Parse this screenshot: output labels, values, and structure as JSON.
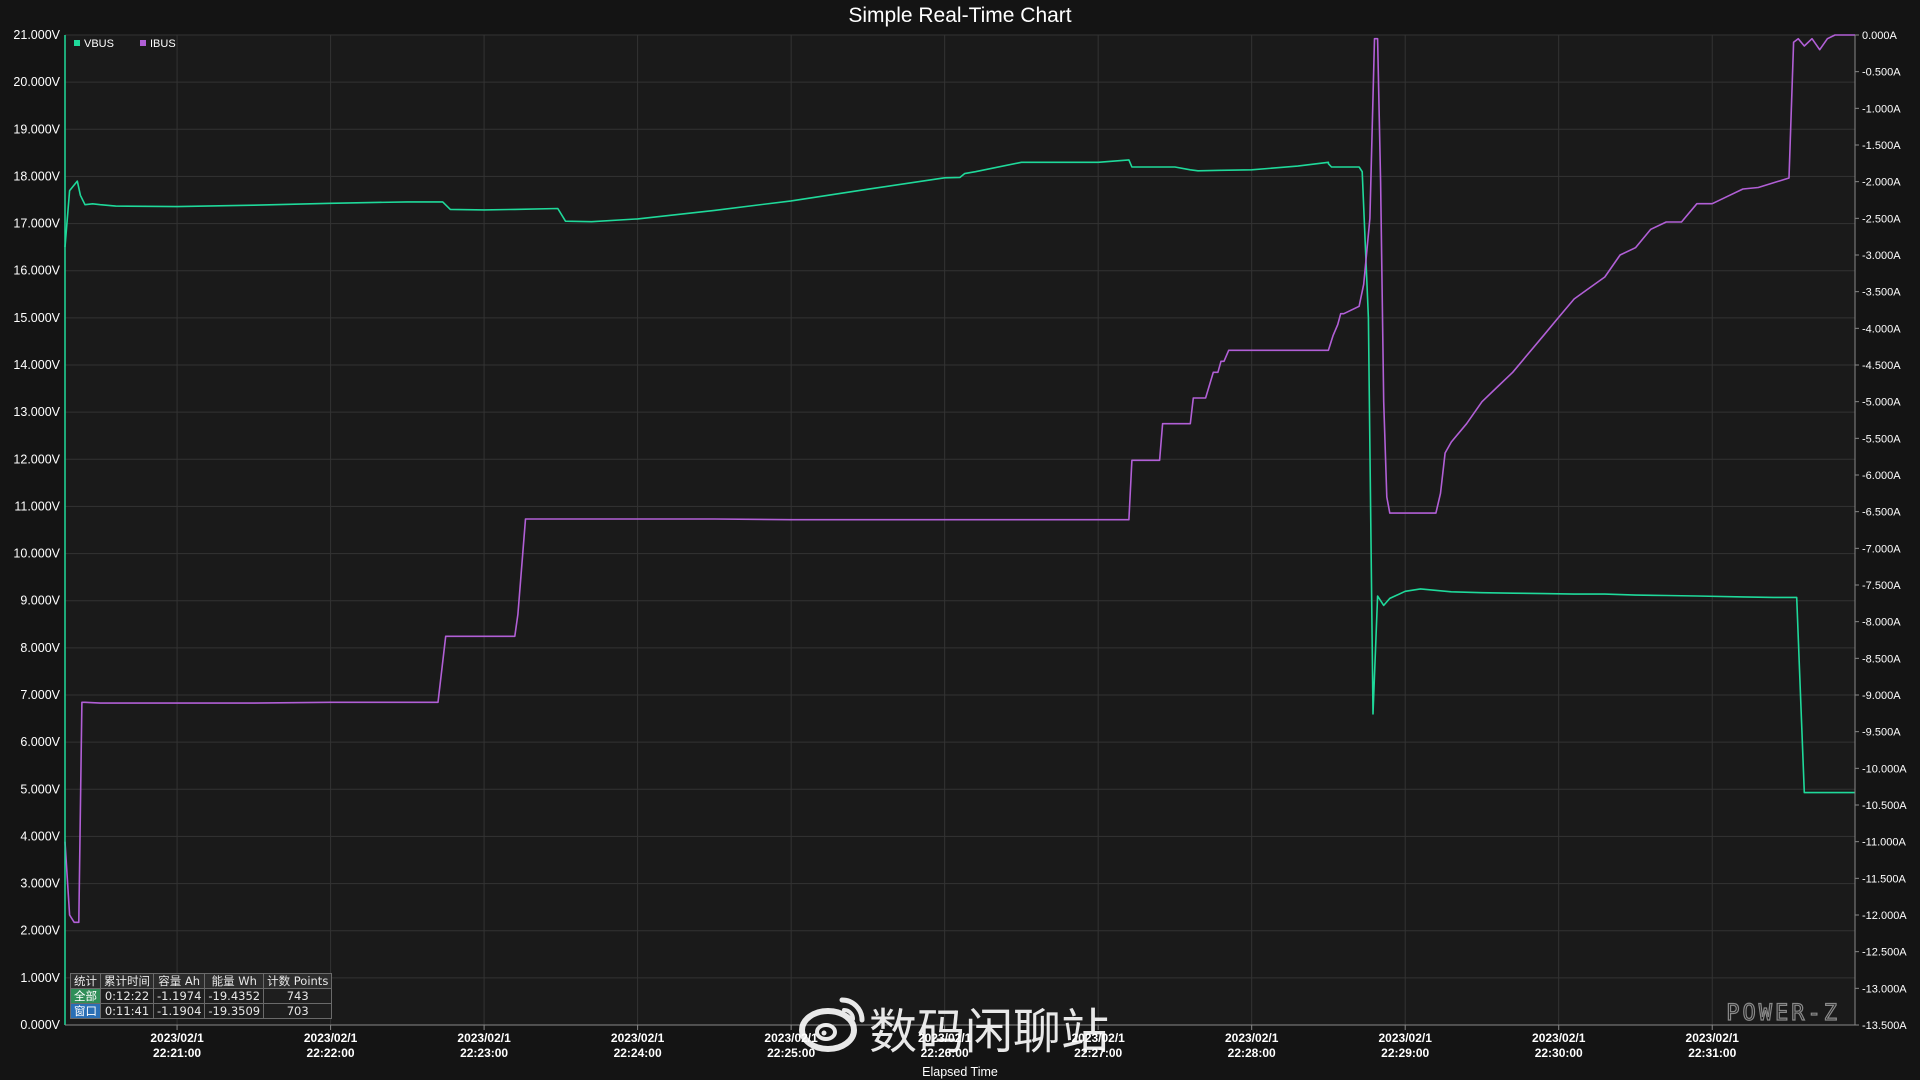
{
  "colors": {
    "background": "#141414",
    "plot_background": "#1a1a1a",
    "grid": "#333333",
    "vbus": "#1fd99a",
    "ibus": "#b15fd6",
    "text": "#ffffff"
  },
  "chart_data": {
    "type": "line",
    "title": "Simple Real-Time Chart",
    "xlabel": "Elapsed Time",
    "x_ticks": [
      {
        "date": "2023/02/1",
        "time": "22:21:00",
        "t": 1
      },
      {
        "date": "2023/02/1",
        "time": "22:22:00",
        "t": 2
      },
      {
        "date": "2023/02/1",
        "time": "22:23:00",
        "t": 3
      },
      {
        "date": "2023/02/1",
        "time": "22:24:00",
        "t": 4
      },
      {
        "date": "2023/02/1",
        "time": "22:25:00",
        "t": 5
      },
      {
        "date": "2023/02/1",
        "time": "22:26:00",
        "t": 6
      },
      {
        "date": "2023/02/1",
        "time": "22:27:00",
        "t": 7
      },
      {
        "date": "2023/02/1",
        "time": "22:28:00",
        "t": 8
      },
      {
        "date": "2023/02/1",
        "time": "22:29:00",
        "t": 9
      },
      {
        "date": "2023/02/1",
        "time": "22:30:00",
        "t": 10
      },
      {
        "date": "2023/02/1",
        "time": "22:31:00",
        "t": 11
      }
    ],
    "xlim": [
      0.27,
      11.93
    ],
    "y_left": {
      "ylim": [
        0,
        21
      ],
      "unit": "V",
      "ticks": [
        "0.000V",
        "1.000V",
        "2.000V",
        "3.000V",
        "4.000V",
        "5.000V",
        "6.000V",
        "7.000V",
        "8.000V",
        "9.000V",
        "10.000V",
        "11.000V",
        "12.000V",
        "13.000V",
        "14.000V",
        "15.000V",
        "16.000V",
        "17.000V",
        "18.000V",
        "19.000V",
        "20.000V",
        "21.000V"
      ]
    },
    "y_right": {
      "ylim": [
        -13.5,
        0
      ],
      "unit": "A",
      "ticks": [
        "0.000A",
        "-0.500A",
        "-1.000A",
        "-1.500A",
        "-2.000A",
        "-2.500A",
        "-3.000A",
        "-3.500A",
        "-4.000A",
        "-4.500A",
        "-5.000A",
        "-5.500A",
        "-6.000A",
        "-6.500A",
        "-7.000A",
        "-7.500A",
        "-8.000A",
        "-8.500A",
        "-9.000A",
        "-9.500A",
        "-10.000A",
        "-10.500A",
        "-11.000A",
        "-11.500A",
        "-12.000A",
        "-12.500A",
        "-13.000A",
        "-13.500A"
      ]
    },
    "legend": {
      "placement": "top-left",
      "entries": [
        "VBUS",
        "IBUS"
      ]
    },
    "grid": true,
    "series": [
      {
        "name": "VBUS",
        "axis": "left",
        "x": [
          0.27,
          0.3,
          0.35,
          0.37,
          0.4,
          0.45,
          0.5,
          0.6,
          1.0,
          1.5,
          2.0,
          2.5,
          2.73,
          2.78,
          3.0,
          3.2,
          3.48,
          3.53,
          3.7,
          4.0,
          4.5,
          5.0,
          5.5,
          6.0,
          6.1,
          6.13,
          6.2,
          6.5,
          7.0,
          7.2,
          7.22,
          7.5,
          7.6,
          7.65,
          7.8,
          8.0,
          8.3,
          8.5,
          8.5,
          8.52,
          8.7,
          8.72,
          8.76,
          8.79,
          8.82,
          8.86,
          8.9,
          9.0,
          9.1,
          9.3,
          9.5,
          9.7,
          9.9,
          10.1,
          10.3,
          10.5,
          10.7,
          10.9,
          11.2,
          11.4,
          11.55,
          11.6,
          11.93
        ],
        "y": [
          16.5,
          17.7,
          17.9,
          17.6,
          17.4,
          17.42,
          17.4,
          17.37,
          17.36,
          17.39,
          17.43,
          17.46,
          17.46,
          17.3,
          17.29,
          17.3,
          17.32,
          17.05,
          17.04,
          17.1,
          17.28,
          17.48,
          17.73,
          17.97,
          17.98,
          18.06,
          18.1,
          18.3,
          18.3,
          18.35,
          18.2,
          18.2,
          18.14,
          18.12,
          18.13,
          18.14,
          18.22,
          18.3,
          18.27,
          18.2,
          18.2,
          18.1,
          15.0,
          6.6,
          9.1,
          8.9,
          9.05,
          9.2,
          9.25,
          9.19,
          9.17,
          9.16,
          9.15,
          9.14,
          9.14,
          9.12,
          9.11,
          9.1,
          9.08,
          9.07,
          9.07,
          4.93,
          4.93
        ]
      },
      {
        "name": "IBUS",
        "axis": "right",
        "x": [
          0.27,
          0.3,
          0.33,
          0.36,
          0.38,
          0.4,
          0.5,
          1.0,
          1.5,
          2.0,
          2.5,
          2.7,
          2.75,
          3.0,
          3.2,
          3.22,
          3.27,
          3.5,
          4.0,
          4.5,
          5.0,
          5.5,
          6.0,
          6.5,
          7.0,
          7.2,
          7.22,
          7.25,
          7.4,
          7.42,
          7.45,
          7.6,
          7.62,
          7.7,
          7.75,
          7.78,
          7.8,
          7.82,
          7.85,
          8.0,
          8.5,
          8.53,
          8.56,
          8.58,
          8.6,
          8.7,
          8.73,
          8.77,
          8.8,
          8.82,
          8.84,
          8.86,
          8.88,
          8.9,
          8.95,
          9.0,
          9.1,
          9.2,
          9.23,
          9.26,
          9.3,
          9.4,
          9.5,
          9.6,
          9.7,
          9.8,
          9.9,
          10.0,
          10.1,
          10.2,
          10.3,
          10.4,
          10.5,
          10.6,
          10.7,
          10.8,
          10.9,
          11.0,
          11.1,
          11.2,
          11.3,
          11.5,
          11.53,
          11.56,
          11.6,
          11.65,
          11.7,
          11.75,
          11.8,
          11.93
        ],
        "y": [
          -11.0,
          -12.0,
          -12.1,
          -12.1,
          -9.1,
          -9.1,
          -9.11,
          -9.11,
          -9.11,
          -9.1,
          -9.1,
          -9.1,
          -8.2,
          -8.2,
          -8.2,
          -7.9,
          -6.6,
          -6.6,
          -6.6,
          -6.6,
          -6.61,
          -6.61,
          -6.61,
          -6.61,
          -6.61,
          -6.61,
          -5.8,
          -5.8,
          -5.8,
          -5.3,
          -5.3,
          -5.3,
          -4.95,
          -4.95,
          -4.6,
          -4.6,
          -4.45,
          -4.45,
          -4.3,
          -4.3,
          -4.3,
          -4.1,
          -3.95,
          -3.8,
          -3.8,
          -3.7,
          -3.4,
          -2.5,
          -0.05,
          -0.05,
          -2.0,
          -5.0,
          -6.3,
          -6.52,
          -6.52,
          -6.52,
          -6.52,
          -6.52,
          -6.25,
          -5.7,
          -5.55,
          -5.3,
          -5.0,
          -4.8,
          -4.6,
          -4.35,
          -4.1,
          -3.85,
          -3.6,
          -3.45,
          -3.3,
          -3.0,
          -2.9,
          -2.65,
          -2.55,
          -2.55,
          -2.3,
          -2.3,
          -2.2,
          -2.1,
          -2.08,
          -1.95,
          -0.1,
          -0.05,
          -0.15,
          -0.05,
          -0.2,
          -0.05,
          0.0,
          0.0
        ]
      }
    ]
  },
  "stats_table": {
    "headers": [
      "统计",
      "累计时间",
      "容量 Ah",
      "能量 Wh",
      "计数 Points"
    ],
    "rows": [
      {
        "label": "全部",
        "time": "0:12:22",
        "capacity": "-1.1974",
        "energy": "-19.4352",
        "points": "743"
      },
      {
        "label": "窗口",
        "time": "0:11:41",
        "capacity": "-1.1904",
        "energy": "-19.3509",
        "points": "703"
      }
    ]
  },
  "watermark": {
    "text": "数码闲聊站",
    "icon": "weibo-icon"
  },
  "brand": {
    "text": "POWER-Z"
  }
}
